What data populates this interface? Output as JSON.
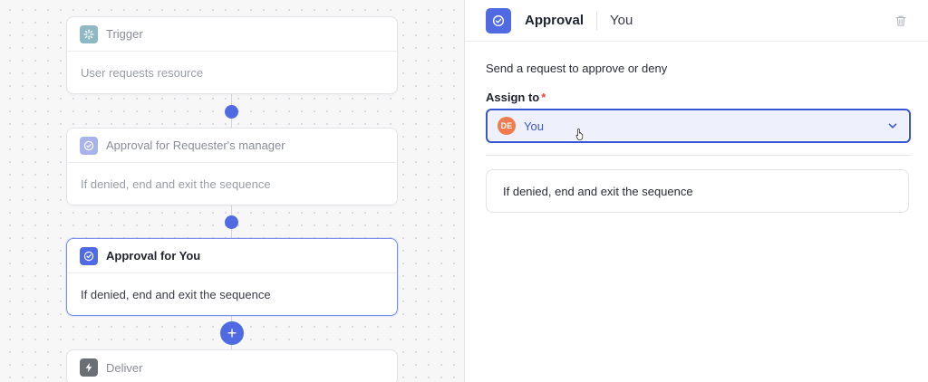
{
  "workflow": {
    "steps": [
      {
        "title": "Trigger",
        "body": "User requests resource",
        "icon": "sparkle-icon"
      },
      {
        "title": "Approval for Requester's manager",
        "body": "If denied, end and exit the sequence",
        "icon": "check-circle-icon"
      },
      {
        "title": "Approval for You",
        "body": "If denied, end and exit the sequence",
        "icon": "check-circle-icon"
      },
      {
        "title": "Deliver",
        "body": "",
        "icon": "lightning-icon"
      }
    ],
    "add_step_label": "+"
  },
  "panel": {
    "title": "Approval",
    "subtitle": "You",
    "description": "Send a request to approve or deny",
    "assign_label": "Assign to",
    "required_mark": "*",
    "assignee": {
      "initials": "DE",
      "name": "You"
    },
    "rule": "If denied, end and exit the sequence"
  },
  "colors": {
    "accent": "#4f6ae3",
    "avatar": "#ef7b4e",
    "required": "#e0463d"
  }
}
